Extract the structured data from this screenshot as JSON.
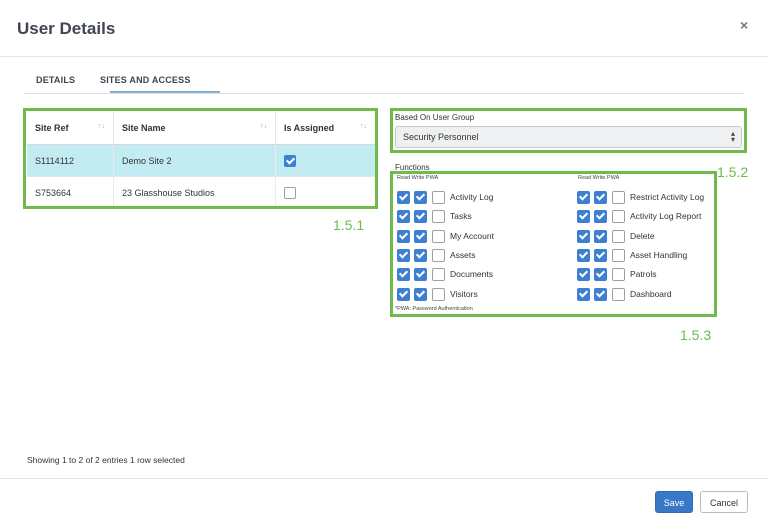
{
  "modal": {
    "title": "User Details",
    "close_label": "×"
  },
  "tabs": [
    {
      "label": "DETAILS",
      "active": false
    },
    {
      "label": "SITES AND ACCESS",
      "active": true
    }
  ],
  "sites_table": {
    "columns": [
      "Site Ref",
      "Site Name",
      "Is Assigned"
    ],
    "sort_glyph": "↑↓",
    "rows": [
      {
        "site_ref": "S1114112",
        "site_name": "Demo Site 2",
        "assigned": true,
        "selected": true
      },
      {
        "site_ref": "S753664",
        "site_name": "23 Glasshouse Studios",
        "assigned": false,
        "selected": false
      }
    ],
    "showing_text": "Showing 1 to 2 of 2 entries   1 row selected"
  },
  "user_group": {
    "label": "Based On User Group",
    "value": "Security Personnel"
  },
  "functions": {
    "label": "Functions",
    "column_header": "Read Write PWA",
    "left": [
      {
        "name": "Activity Log",
        "read": true,
        "write": true,
        "pwa": false
      },
      {
        "name": "Tasks",
        "read": true,
        "write": true,
        "pwa": false
      },
      {
        "name": "My Account",
        "read": true,
        "write": true,
        "pwa": false
      },
      {
        "name": "Assets",
        "read": true,
        "write": true,
        "pwa": false
      },
      {
        "name": "Documents",
        "read": true,
        "write": true,
        "pwa": false
      },
      {
        "name": "Visitors",
        "read": true,
        "write": true,
        "pwa": false
      }
    ],
    "right": [
      {
        "name": "Restrict Activity Log",
        "read": true,
        "write": true,
        "pwa": false
      },
      {
        "name": "Activity Log Report",
        "read": true,
        "write": true,
        "pwa": false
      },
      {
        "name": "Delete",
        "read": true,
        "write": true,
        "pwa": false
      },
      {
        "name": "Asset Handling",
        "read": true,
        "write": true,
        "pwa": false
      },
      {
        "name": "Patrols",
        "read": true,
        "write": true,
        "pwa": false
      },
      {
        "name": "Dashboard",
        "read": true,
        "write": true,
        "pwa": false
      }
    ],
    "pwa_note": "*PWA: Password Authentication"
  },
  "annotations": [
    "1.5.1",
    "1.5.2",
    "1.5.3"
  ],
  "footer": {
    "save_label": "Save",
    "cancel_label": "Cancel"
  },
  "colors": {
    "accent": "#3878c7",
    "highlight_box": "#6fba4a",
    "selected_row": "#c2ecf1"
  }
}
